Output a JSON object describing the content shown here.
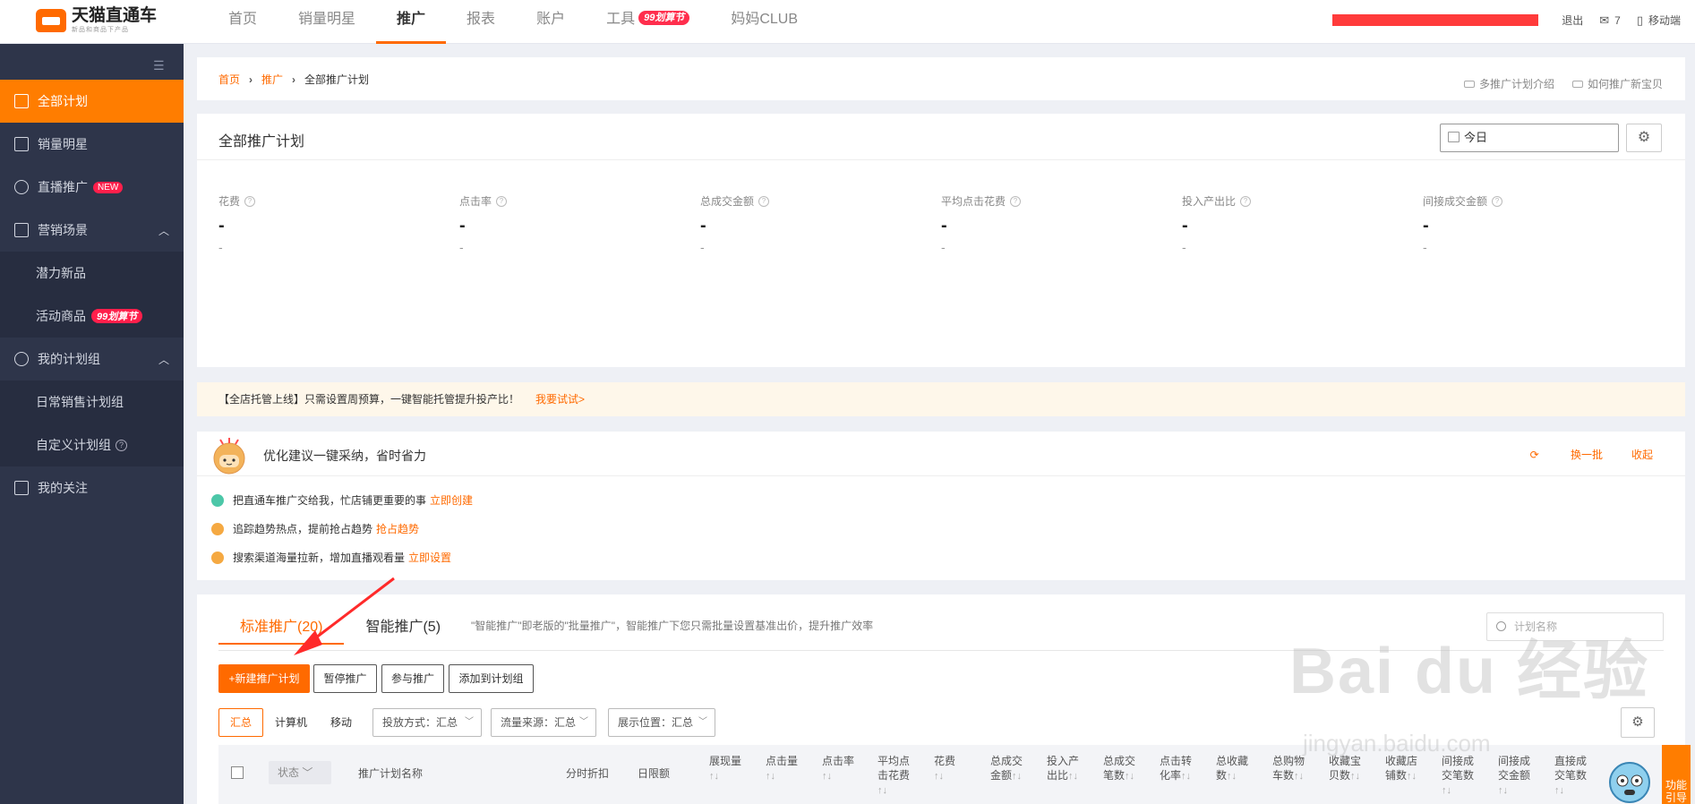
{
  "brand": {
    "title": "天猫直通车",
    "subtitle": "新品和商品下产品"
  },
  "nav": {
    "items": [
      {
        "label": "首页"
      },
      {
        "label": "销量明星"
      },
      {
        "label": "推广"
      },
      {
        "label": "报表"
      },
      {
        "label": "账户"
      },
      {
        "label": "工具",
        "badge": "99划算节"
      },
      {
        "label": "妈妈CLUB"
      }
    ],
    "active": "推广"
  },
  "topright": {
    "logout": "退出",
    "messages": "7",
    "mobile": "移动端"
  },
  "sidebar": {
    "items": [
      {
        "label": "全部计划"
      },
      {
        "label": "销量明星"
      },
      {
        "label": "直播推广",
        "badge": "NEW"
      },
      {
        "label": "营销场景"
      },
      {
        "label": "潜力新品"
      },
      {
        "label": "活动商品",
        "badge": "99划算节"
      },
      {
        "label": "我的计划组"
      },
      {
        "label": "日常销售计划组"
      },
      {
        "label": "自定义计划组"
      },
      {
        "label": "我的关注"
      }
    ]
  },
  "breadcrumb": {
    "home": "首页",
    "promo": "推广",
    "current": "全部推广计划"
  },
  "video_links": {
    "a": "多推广计划介绍",
    "b": "如何推广新宝贝"
  },
  "overview": {
    "title": "全部推广计划",
    "date": "今日",
    "metrics": [
      {
        "label": "花费",
        "value": "-",
        "compare": "-"
      },
      {
        "label": "点击率",
        "value": "-",
        "compare": "-"
      },
      {
        "label": "总成交金额",
        "value": "-",
        "compare": "-"
      },
      {
        "label": "平均点击花费",
        "value": "-",
        "compare": "-"
      },
      {
        "label": "投入产出比",
        "value": "-",
        "compare": "-"
      },
      {
        "label": "间接成交金额",
        "value": "-",
        "compare": "-"
      }
    ]
  },
  "notice": {
    "text": "【全店托管上线】只需设置周预算，一键智能托管提升投产比！",
    "link": "我要试试>"
  },
  "optimize": {
    "title": "优化建议一键采纳，省时省力",
    "refresh": "换一批",
    "collapse": "收起",
    "tips": [
      {
        "text": "把直通车推广交给我，忙店铺更重要的事",
        "link": "立即创建",
        "color": "#4cc7a8"
      },
      {
        "text": "追踪趋势热点，提前抢占趋势",
        "link": "抢占趋势",
        "color": "#f5a942"
      },
      {
        "text": "搜索渠道海量拉新，增加直播观看量",
        "link": "立即设置",
        "color": "#f5a942"
      }
    ]
  },
  "tabs": {
    "standard": "标准推广(20)",
    "smart": "智能推广(5)",
    "desc": "\"智能推广\"即老版的\"批量推广\"，智能推广下您只需批量设置基准出价，提升推广效率",
    "search_placeholder": "计划名称"
  },
  "actions": {
    "new_plan": "+新建推广计划",
    "pause": "暂停推广",
    "join": "参与推广",
    "add_group": "添加到计划组"
  },
  "filters": {
    "segments": [
      "汇总",
      "计算机",
      "移动"
    ],
    "method": "投放方式：汇总",
    "source": "流量来源：汇总",
    "position": "展示位置：汇总"
  },
  "table": {
    "status": "状态",
    "columns": [
      "推广计划名称",
      "分时折扣",
      "日限额",
      "展现量",
      "点击量",
      "点击率",
      "平均点击花费",
      "花费",
      "总成交金额",
      "投入产出比",
      "总成交笔数",
      "点击转化率",
      "总收藏数",
      "总购物车数",
      "收藏宝贝数",
      "收藏店铺数",
      "间接成交笔数",
      "间接成交金额",
      "直接成交笔数"
    ]
  },
  "watermark": {
    "main": "Bai du 经验",
    "sub": "jingyan.baidu.com"
  },
  "help_tab": "功能引导",
  "colors": {
    "accent": "#ff6a00",
    "sidebar": "#2e354a",
    "sidebar_active": "#ff7d00",
    "badge_red": "#ff1f4b"
  }
}
